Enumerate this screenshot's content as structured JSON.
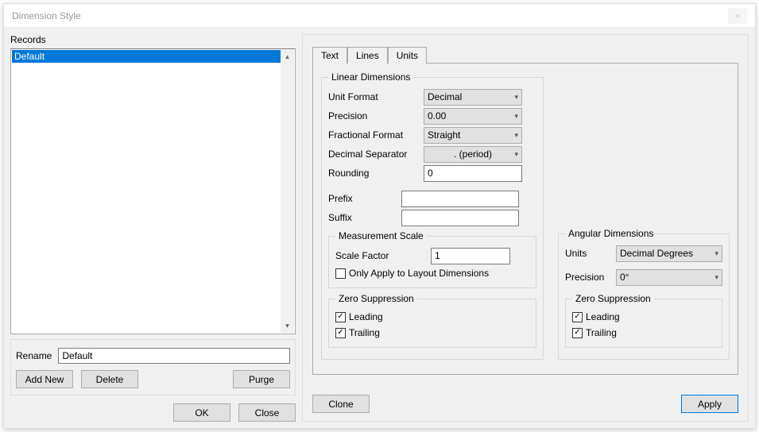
{
  "window": {
    "title": "Dimension Style",
    "close": "×"
  },
  "records": {
    "label": "Records",
    "selected": "Default"
  },
  "rename": {
    "label": "Rename",
    "value": "Default"
  },
  "buttons": {
    "add_new": "Add New",
    "delete": "Delete",
    "purge": "Purge",
    "ok": "OK",
    "close": "Close",
    "clone": "Clone",
    "apply": "Apply"
  },
  "tabs": {
    "text": "Text",
    "lines": "Lines",
    "units": "Units"
  },
  "linear": {
    "legend": "Linear Dimensions",
    "unit_format_label": "Unit Format",
    "unit_format_value": "Decimal",
    "precision_label": "Precision",
    "precision_value": "0.00",
    "fractional_label": "Fractional Format",
    "fractional_value": "Straight",
    "separator_label": "Decimal Separator",
    "separator_value": ". (period)",
    "rounding_label": "Rounding",
    "rounding_value": "0",
    "prefix_label": "Prefix",
    "prefix_value": "",
    "suffix_label": "Suffix",
    "suffix_value": ""
  },
  "measurement": {
    "legend": "Measurement Scale",
    "scale_label": "Scale Factor",
    "scale_value": "1",
    "layout_only": "Only Apply to Layout Dimensions"
  },
  "zero_linear": {
    "legend": "Zero Suppression",
    "leading": "Leading",
    "trailing": "Trailing"
  },
  "angular": {
    "legend": "Angular Dimensions",
    "units_label": "Units",
    "units_value": "Decimal Degrees",
    "precision_label": "Precision",
    "precision_value": "0°"
  },
  "zero_angular": {
    "legend": "Zero Suppression",
    "leading": "Leading",
    "trailing": "Trailing"
  }
}
